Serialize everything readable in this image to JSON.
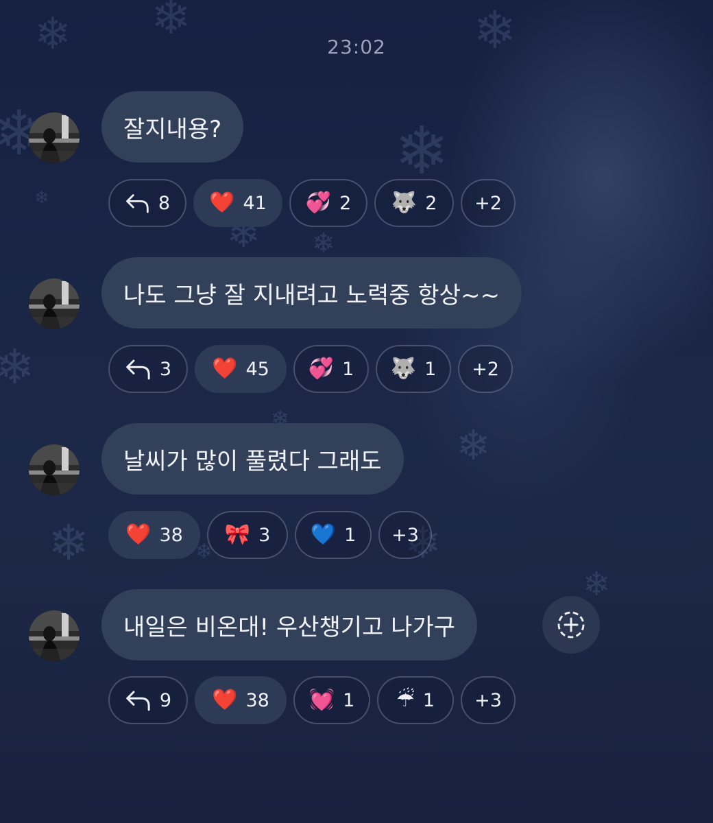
{
  "timestamp": "23:02",
  "colors": {
    "background": "#1a2546",
    "bubble": "#324059",
    "chip_border": "#5a6480",
    "chip_active": "#2e3b56",
    "heart_red": "#e0232b"
  },
  "messages": [
    {
      "text": "잘지내용?",
      "reactions": [
        {
          "type": "reply",
          "icon": "reply-arrow-icon",
          "count": "8"
        },
        {
          "type": "emoji",
          "emoji": "❤️",
          "icon": "red-heart-icon",
          "count": "41",
          "active": true
        },
        {
          "type": "emoji",
          "emoji": "💞",
          "icon": "revolving-hearts-icon",
          "count": "2"
        },
        {
          "type": "emoji",
          "emoji": "🐺",
          "icon": "wolf-icon",
          "count": "2"
        },
        {
          "type": "more",
          "label": "+2"
        }
      ]
    },
    {
      "text": "나도 그냥 잘 지내려고 노력중 항상~~",
      "reactions": [
        {
          "type": "reply",
          "icon": "reply-arrow-icon",
          "count": "3"
        },
        {
          "type": "emoji",
          "emoji": "❤️",
          "icon": "red-heart-icon",
          "count": "45",
          "active": true
        },
        {
          "type": "emoji",
          "emoji": "💞",
          "icon": "revolving-hearts-icon",
          "count": "1"
        },
        {
          "type": "emoji",
          "emoji": "🐺",
          "icon": "wolf-icon",
          "count": "1"
        },
        {
          "type": "more",
          "label": "+2"
        }
      ]
    },
    {
      "text": "날씨가 많이 풀렸다 그래도",
      "reactions": [
        {
          "type": "emoji",
          "emoji": "❤️",
          "icon": "red-heart-icon",
          "count": "38",
          "active": true
        },
        {
          "type": "emoji",
          "emoji": "🎀",
          "icon": "ribbon-icon",
          "count": "3"
        },
        {
          "type": "emoji",
          "emoji": "💙",
          "icon": "blue-heart-icon",
          "count": "1"
        },
        {
          "type": "more",
          "label": "+3"
        }
      ]
    },
    {
      "text": "내일은 비온대! 우산챙기고 나가구",
      "reactions": [
        {
          "type": "reply",
          "icon": "reply-arrow-icon",
          "count": "9"
        },
        {
          "type": "emoji",
          "emoji": "❤️",
          "icon": "red-heart-icon",
          "count": "38",
          "active": true
        },
        {
          "type": "emoji",
          "emoji": "💓",
          "icon": "beating-heart-icon",
          "count": "1"
        },
        {
          "type": "emoji",
          "emoji": "☔",
          "icon": "umbrella-rain-icon",
          "count": "1"
        },
        {
          "type": "more",
          "label": "+3"
        }
      ]
    }
  ],
  "add_reaction_icon": "add-reaction-icon"
}
